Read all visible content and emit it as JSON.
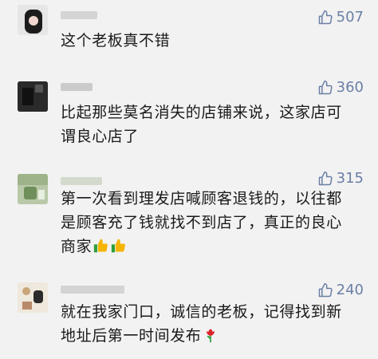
{
  "comments": [
    {
      "likes": "507",
      "text": "这个老板真不错"
    },
    {
      "likes": "360",
      "text": "比起那些莫名消失的店铺来说，这家店可\n谓良心店了"
    },
    {
      "likes": "315",
      "text": "第一次看到理发店喊顾客退钱的，以往都\n是顾客充了钱就找不到店了，真正的良心\n商家",
      "emoji": [
        "thumbs-up",
        "thumbs-up"
      ]
    },
    {
      "likes": "240",
      "text": "就在我家门口，诚信的老板，记得找到新\n地址后第一时间发布",
      "emoji": [
        "rose"
      ]
    }
  ],
  "colors": {
    "background": "#f2f2f2",
    "like_accent": "#6b7fa6",
    "text": "#1a1a1a"
  },
  "icons": {
    "like": "thumbs-up-outline-icon",
    "emoji_thumbs": "thumbs-up-emoji-icon",
    "emoji_rose": "rose-emoji-icon"
  }
}
